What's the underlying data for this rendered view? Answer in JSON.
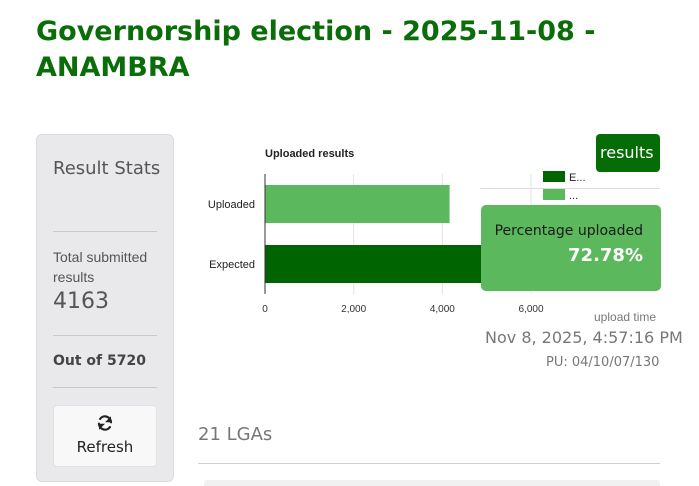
{
  "page": {
    "title": "Governorship election - 2025-11-08 - ANAMBRA"
  },
  "stats": {
    "heading": "Result Stats",
    "total_label": "Total submitted results",
    "total_value": "4163",
    "out_of": "Out of 5720",
    "refresh_label": "Refresh",
    "refresh_icon": "refresh-icon"
  },
  "results_button": {
    "label": "results"
  },
  "legend": {
    "items": [
      {
        "label": "E...",
        "color": "#006400"
      },
      {
        "label": "...",
        "color": "#5cb85c"
      }
    ]
  },
  "percentage": {
    "label": "Percentage uploaded",
    "value": "72.78%"
  },
  "upload": {
    "label": "upload time",
    "time": "Nov 8, 2025, 4:57:16 PM",
    "pu": "PU: 04/10/07/130"
  },
  "lgas": {
    "heading": "21 LGAs"
  },
  "colors": {
    "title_green": "#0a6d0a",
    "dark_green": "#006400",
    "light_green": "#5cb85c"
  },
  "chart_data": {
    "type": "bar",
    "orientation": "horizontal",
    "title": "Uploaded results",
    "categories": [
      "Uploaded",
      "Expected"
    ],
    "series": [
      {
        "values": [
          4163,
          5720
        ],
        "colors": [
          "#5cb85c",
          "#006400"
        ]
      }
    ],
    "x_ticks": [
      "0",
      "2,000",
      "4,000",
      "6,000"
    ],
    "xlim": [
      0,
      6000
    ],
    "grid": true,
    "legend_position": "top-right"
  }
}
